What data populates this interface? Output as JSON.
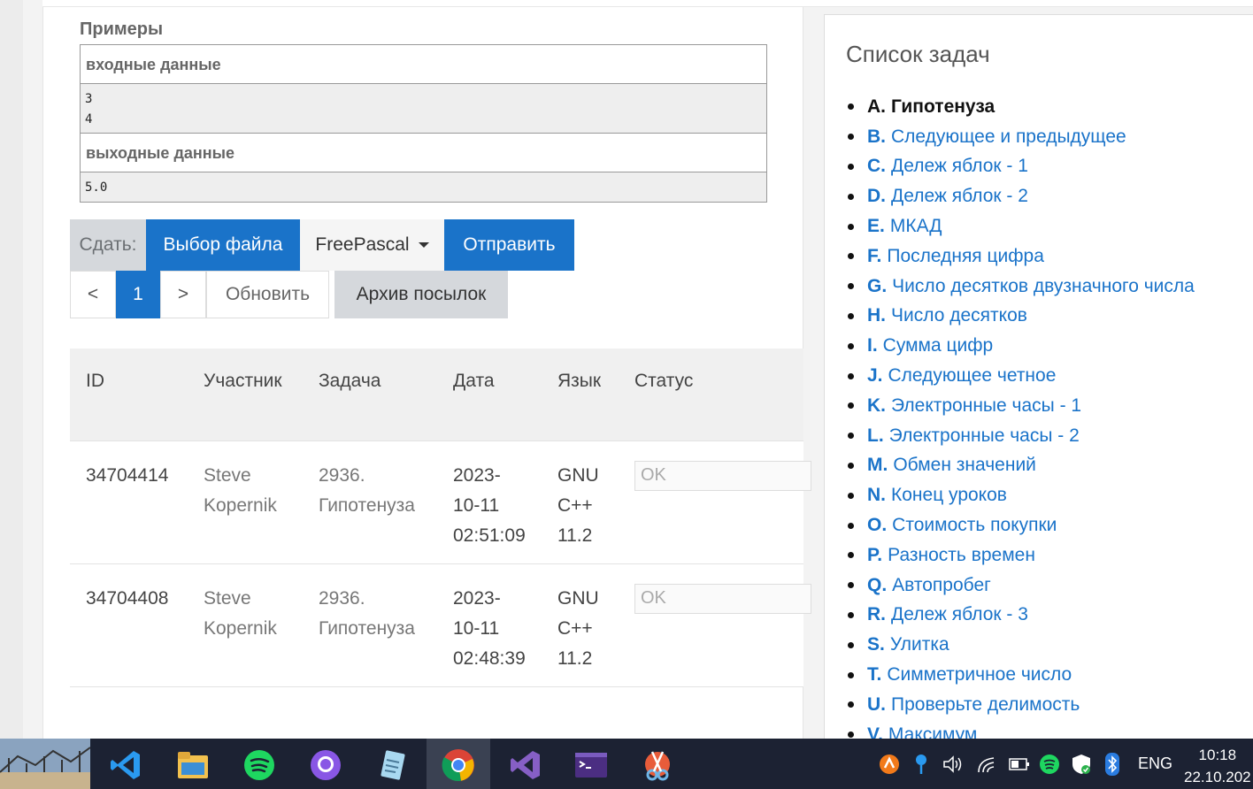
{
  "examples": {
    "title": "Примеры",
    "input_header": "входные данные",
    "input_lines": [
      "3",
      "4"
    ],
    "output_header": "выходные данные",
    "output_lines": [
      "5.0"
    ]
  },
  "submit": {
    "label": "Сдать:",
    "file_button": "Выбор файла",
    "language": "FreePascal",
    "send_button": "Отправить"
  },
  "pager": {
    "prev": "<",
    "current": "1",
    "next": ">",
    "refresh": "Обновить",
    "archive": "Архив посылок"
  },
  "table": {
    "headers": [
      "ID",
      "Участник",
      "Задача",
      "Дата",
      "Язык",
      "Статус"
    ],
    "rows": [
      {
        "id": "34704414",
        "participant": [
          "Steve",
          "Kopernik"
        ],
        "task": [
          "2936.",
          "Гипотенуза"
        ],
        "date": [
          "2023-",
          "10-11",
          "02:51:09"
        ],
        "lang": [
          "GNU",
          "C++",
          "11.2"
        ],
        "status": "OK"
      },
      {
        "id": "34704408",
        "participant": [
          "Steve",
          "Kopernik"
        ],
        "task": [
          "2936.",
          "Гипотенуза"
        ],
        "date": [
          "2023-",
          "10-11",
          "02:48:39"
        ],
        "lang": [
          "GNU",
          "C++",
          "11.2"
        ],
        "status": "OK"
      }
    ]
  },
  "tasks": {
    "title": "Список задач",
    "items": [
      {
        "letter": "A.",
        "name": "Гипотенуза",
        "current": true
      },
      {
        "letter": "B.",
        "name": "Следующее и предыдущее"
      },
      {
        "letter": "C.",
        "name": "Дележ яблок - 1"
      },
      {
        "letter": "D.",
        "name": "Дележ яблок - 2"
      },
      {
        "letter": "E.",
        "name": "МКАД"
      },
      {
        "letter": "F.",
        "name": "Последняя цифра"
      },
      {
        "letter": "G.",
        "name": "Число десятков двузначного числа"
      },
      {
        "letter": "H.",
        "name": "Число десятков"
      },
      {
        "letter": "I.",
        "name": "Сумма цифр"
      },
      {
        "letter": "J.",
        "name": "Следующее четное"
      },
      {
        "letter": "K.",
        "name": "Электронные часы - 1"
      },
      {
        "letter": "L.",
        "name": "Электронные часы - 2"
      },
      {
        "letter": "M.",
        "name": "Обмен значений"
      },
      {
        "letter": "N.",
        "name": "Конец уроков"
      },
      {
        "letter": "O.",
        "name": "Стоимость покупки"
      },
      {
        "letter": "P.",
        "name": "Разность времен"
      },
      {
        "letter": "Q.",
        "name": "Автопробег"
      },
      {
        "letter": "R.",
        "name": "Дележ яблок - 3"
      },
      {
        "letter": "S.",
        "name": "Улитка"
      },
      {
        "letter": "T.",
        "name": "Симметричное число"
      },
      {
        "letter": "U.",
        "name": "Проверьте делимость"
      },
      {
        "letter": "V.",
        "name": "Максимум"
      }
    ]
  },
  "taskbar": {
    "language": "ENG",
    "time": "10:18",
    "date": "22.10.202",
    "apps": [
      "vscode-icon",
      "file-explorer-icon",
      "spotify-icon",
      "github-desktop-icon",
      "notepad-icon",
      "chrome-icon",
      "visual-studio-icon",
      "terminal-icon",
      "snipping-tool-icon"
    ]
  },
  "colors": {
    "accent": "#1a73c9",
    "taskbar": "#1c2233"
  }
}
